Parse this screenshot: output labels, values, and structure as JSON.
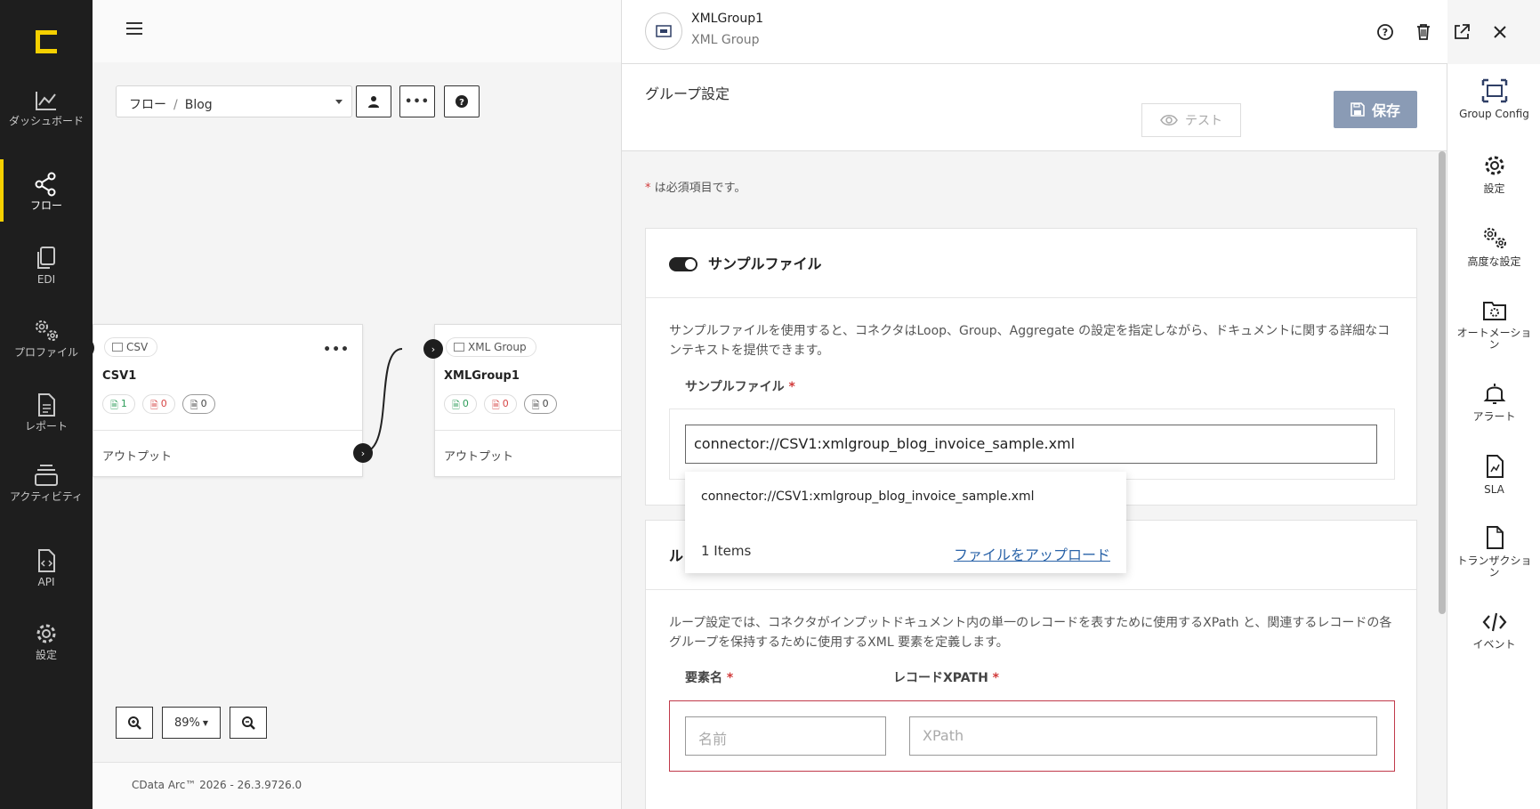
{
  "nav": {
    "items": [
      {
        "label": "ダッシュボード",
        "icon": "chart-line-icon"
      },
      {
        "label": "フロー",
        "icon": "share-nodes-icon"
      },
      {
        "label": "EDI",
        "icon": "copy-icon"
      },
      {
        "label": "プロファイル",
        "icon": "gears-icon"
      },
      {
        "label": "レポート",
        "icon": "document-icon"
      },
      {
        "label": "アクティビティ",
        "icon": "stack-icon"
      },
      {
        "label": "API",
        "icon": "api-file-icon"
      },
      {
        "label": "設定",
        "icon": "gear-icon"
      }
    ],
    "active": "フロー",
    "accent": "#f5d000"
  },
  "breadcrumb": {
    "root": "フロー",
    "sep": "/",
    "current": "Blog"
  },
  "nodes": {
    "csv": {
      "type": "CSV",
      "name": "CSV1",
      "counts": [
        "1",
        "0",
        "0"
      ],
      "output": "アウトプット"
    },
    "xml": {
      "type": "XML Group",
      "name": "XMLGroup1",
      "counts": [
        "0",
        "0",
        "0"
      ],
      "output": "アウトプット"
    }
  },
  "zoom": {
    "level": "89%"
  },
  "footer": {
    "version": "CData Arc™ 2026 - 26.3.9726.0"
  },
  "panel": {
    "title": "XMLGroup1",
    "subtitle": "XML Group",
    "section_title": "グループ設定",
    "test_label": "テスト",
    "save_label": "保存",
    "save_color": "#8a9bb5",
    "required_note": "は必須項目です。",
    "required_star": "*",
    "sample_card": {
      "title": "サンプルファイル",
      "toggle_on": true,
      "description": "サンプルファイルを使用すると、コネクタはLoop、Group、Aggregate の設定を指定しながら、ドキュメントに関する詳細なコンテキストを提供できます。",
      "field_label": "サンプルファイル",
      "field_value": "connector://CSV1:xmlgroup_blog_invoice_sample.xml"
    },
    "dropdown": {
      "option": "connector://CSV1:xmlgroup_blog_invoice_sample.xml",
      "count": "1 Items",
      "upload": "ファイルをアップロード"
    },
    "loop_card": {
      "title_partial": "ル",
      "description": "ループ設定では、コネクタがインプットドキュメント内の単一のレコードを表すために使用するXPath と、関連するレコードの各グループを保持するために使用するXML 要素を定義します。",
      "element_label": "要素名",
      "element_placeholder": "名前",
      "xpath_label": "レコードXPATH",
      "xpath_placeholder": "XPath"
    }
  },
  "rail": {
    "items": [
      {
        "label": "Group Config",
        "icon": "group-config-icon"
      },
      {
        "label": "設定",
        "icon": "gear-icon"
      },
      {
        "label": "高度な設定",
        "icon": "gears-icon"
      },
      {
        "label": "オートメーション",
        "icon": "folder-gear-icon"
      },
      {
        "label": "アラート",
        "icon": "bell-icon"
      },
      {
        "label": "SLA",
        "icon": "sla-file-icon"
      },
      {
        "label": "トランザクション",
        "icon": "file-icon"
      },
      {
        "label": "イベント",
        "icon": "code-icon"
      }
    ]
  }
}
